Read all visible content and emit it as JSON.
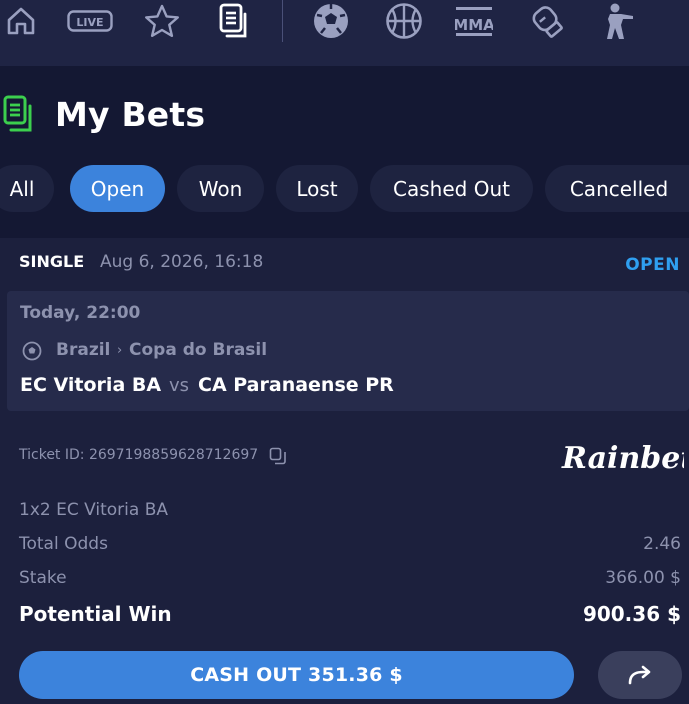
{
  "nav": {
    "items": [
      "home-icon",
      "live-icon",
      "favorites-icon",
      "bets-icon",
      "soccer-icon",
      "basketball-icon",
      "mma-icon",
      "boxing-icon",
      "esports-icon"
    ],
    "live_label": "LIVE",
    "mma_label": "MMA"
  },
  "page": {
    "title": "My Bets"
  },
  "tabs": [
    {
      "label": "All"
    },
    {
      "label": "Open",
      "active": true
    },
    {
      "label": "Won"
    },
    {
      "label": "Lost"
    },
    {
      "label": "Cashed Out"
    },
    {
      "label": "Cancelled"
    }
  ],
  "bet": {
    "type": "SINGLE",
    "date": "Aug 6, 2026, 16:18",
    "status": "OPEN",
    "event": {
      "time": "Today, 22:00",
      "country": "Brazil",
      "separator": "›",
      "league": "Copa do Brasil",
      "home_team": "EC Vitoria BA",
      "vs": "vs",
      "away_team": "CA Paranaense PR"
    },
    "ticket_label": "Ticket ID: 2697198859628712697",
    "brand": "Rainbet",
    "selection": "1x2 EC Vitoria BA",
    "total_odds_label": "Total Odds",
    "total_odds_value": "2.46",
    "stake_label": "Stake",
    "stake_value": "366.00 $",
    "potential_win_label": "Potential Win",
    "potential_win_value": "900.36 $",
    "cashout_label": "CASH OUT 351.36 $"
  },
  "colors": {
    "background": "#141833",
    "nav": "#1f2444",
    "card": "#1c203d",
    "event_panel": "#262b4b",
    "accent_blue": "#3c83dc",
    "status_open": "#2f9ff0",
    "muted_text": "#8d92ae",
    "bets_icon_green": "#3ccf4e"
  }
}
